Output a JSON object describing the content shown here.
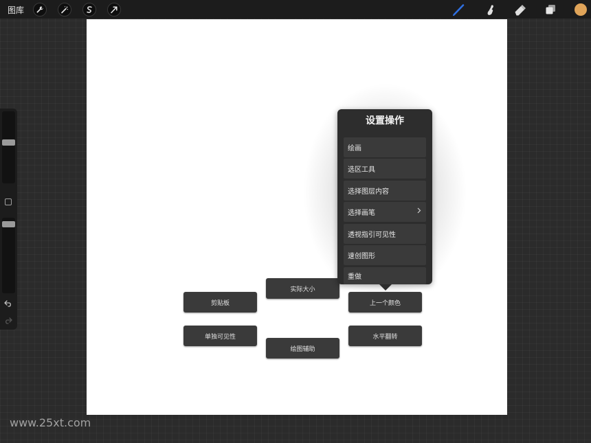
{
  "topbar": {
    "gallery_label": "图库",
    "left_tools": [
      "wrench-icon",
      "magic-wand-icon",
      "selection-icon",
      "transform-arrow-icon"
    ],
    "right_tools": [
      "brush-icon",
      "smudge-icon",
      "eraser-icon",
      "layers-icon"
    ],
    "active_tool": "brush-icon",
    "active_tool_color": "#2f6fe0",
    "current_color": "#e0a459"
  },
  "sidebar": {
    "size_slider_level": 0.57,
    "opacity_slider_level": 0.95,
    "undo_icon": "undo-icon",
    "redo_icon": "redo-icon"
  },
  "gesture_menu": {
    "title": "设置操作",
    "items": [
      {
        "label": "绘画",
        "has_submenu": false
      },
      {
        "label": "选区工具",
        "has_submenu": false
      },
      {
        "label": "选择图层内容",
        "has_submenu": false
      },
      {
        "label": "选择画笔",
        "has_submenu": true
      },
      {
        "label": "透视指引可见性",
        "has_submenu": false
      },
      {
        "label": "速创图形",
        "has_submenu": false
      },
      {
        "label": "重做",
        "has_submenu": false
      }
    ]
  },
  "gesture_buttons": {
    "actual_size": "实际大小",
    "clipboard": "剪贴板",
    "previous_color": "上一个颜色",
    "solo_visibility": "单独可见性",
    "flip_horizontal": "水平翻转",
    "drawing_assist": "绘图辅助"
  },
  "watermark": "www.25xt.com"
}
